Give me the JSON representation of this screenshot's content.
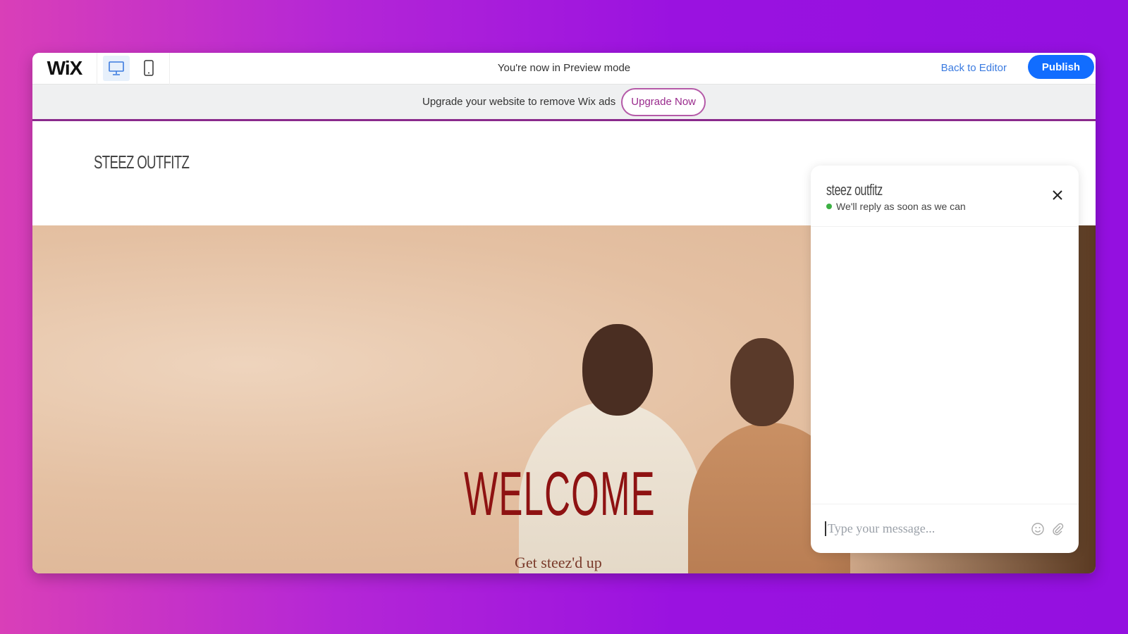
{
  "toolbar": {
    "logo": "WiX",
    "mode_text": "You're now in Preview mode",
    "back_label": "Back to Editor",
    "publish_label": "Publish",
    "devices": [
      "desktop-icon",
      "mobile-icon"
    ]
  },
  "adbar": {
    "text": "Upgrade your website to remove Wix ads",
    "button": "Upgrade Now"
  },
  "site": {
    "title": "STEEZ OUTFITZ",
    "hero_heading": "WELCOME",
    "hero_sub": "Get steez'd up"
  },
  "chat": {
    "name": "steez outfitz",
    "status": "We'll reply as soon as we can",
    "placeholder": "Type your message...",
    "icons": [
      "emoji-icon",
      "attachment-icon",
      "close-icon"
    ]
  },
  "colors": {
    "accent": "#116dff",
    "welcome": "#8e1212",
    "upgrade": "#9a2b8d",
    "online": "#3cb043"
  }
}
